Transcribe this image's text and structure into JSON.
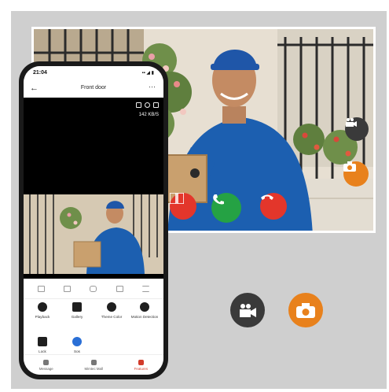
{
  "phone": {
    "status_time": "21:04",
    "status_icons": "▪▪ ◢ ▮",
    "title": "Front door",
    "back_glyph": "←",
    "more_glyph": "···",
    "bitrate": "142 KB/S",
    "features": [
      {
        "label": "Playback",
        "icon": "play-icon"
      },
      {
        "label": "Gallery",
        "icon": "gallery-icon"
      },
      {
        "label": "Theme Color",
        "icon": "palette-icon"
      },
      {
        "label": "Motion Detection",
        "icon": "motion-icon"
      },
      {
        "label": "Lock",
        "icon": "lock-icon"
      },
      {
        "label": "Sos",
        "icon": "sos-icon"
      }
    ],
    "nav": [
      {
        "label": "Message",
        "icon": "message-icon",
        "active": false
      },
      {
        "label": "Mimtec Mall",
        "icon": "cart-icon",
        "active": false
      },
      {
        "label": "Features",
        "icon": "features-icon",
        "active": true
      }
    ]
  },
  "colors": {
    "accept": "#25a244",
    "decline": "#e3362b",
    "orange": "#e8811c",
    "dark": "#3a3a3a",
    "uniform": "#1c5fb0"
  },
  "icons": {
    "video_call": "video-call-icon",
    "camera": "camera-icon"
  }
}
